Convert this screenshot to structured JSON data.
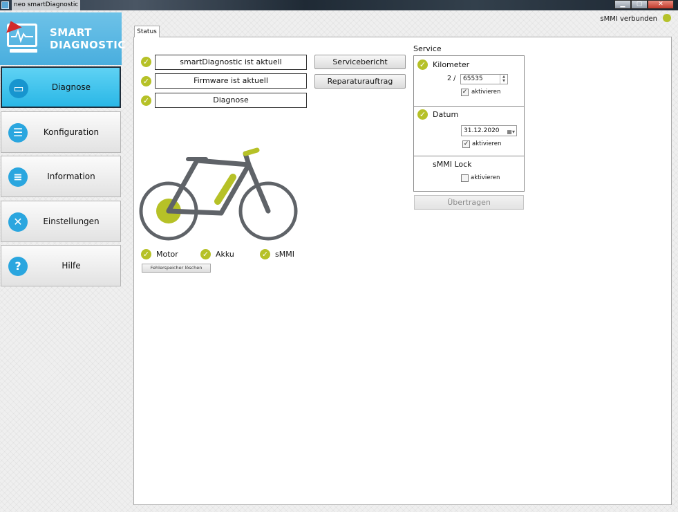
{
  "window": {
    "title": "neo smartDiagnostic",
    "btn_minimize": "▁",
    "btn_maximize": "▢",
    "btn_close": "✕"
  },
  "logo": {
    "line1": "SMART",
    "line2": "DIAGNOSTIC"
  },
  "sidebar": {
    "items": [
      {
        "label": "Diagnose",
        "icon": "monitor-icon",
        "glyph": "▭",
        "active": true
      },
      {
        "label": "Konfiguration",
        "icon": "config-icon",
        "glyph": "☰",
        "active": false
      },
      {
        "label": "Information",
        "icon": "book-icon",
        "glyph": "≡",
        "active": false
      },
      {
        "label": "Einstellungen",
        "icon": "tools-icon",
        "glyph": "✕",
        "active": false
      },
      {
        "label": "Hilfe",
        "icon": "help-icon",
        "glyph": "?",
        "active": false
      }
    ]
  },
  "connection": {
    "text": "sMMI verbunden",
    "color": "#b5c22a"
  },
  "tab": {
    "label": "Status"
  },
  "status": {
    "items": [
      {
        "text": "smartDiagnostic ist aktuell"
      },
      {
        "text": "Firmware ist aktuell"
      },
      {
        "text": "Diagnose"
      }
    ],
    "buttons": {
      "report": "Servicebericht",
      "repair": "Reparaturauftrag"
    }
  },
  "components": {
    "motor": "Motor",
    "battery": "Akku",
    "smmi": "sMMI",
    "clear_button": "Fehlerspeicher löschen"
  },
  "service": {
    "title": "Service",
    "kilometer": {
      "label": "Kilometer",
      "prefix": "2 /",
      "value": "65535",
      "activate_label": "aktivieren",
      "activate_checked": true
    },
    "date": {
      "label": "Datum",
      "value": "31.12.2020",
      "activate_label": "aktivieren",
      "activate_checked": true
    },
    "lock": {
      "label": "sMMI Lock",
      "activate_label": "aktivieren",
      "activate_checked": false
    },
    "transfer_button": "Übertragen"
  },
  "colors": {
    "accent": "#b6c127",
    "active_nav": "#2ab7e6",
    "bike_frame": "#5f6368"
  }
}
